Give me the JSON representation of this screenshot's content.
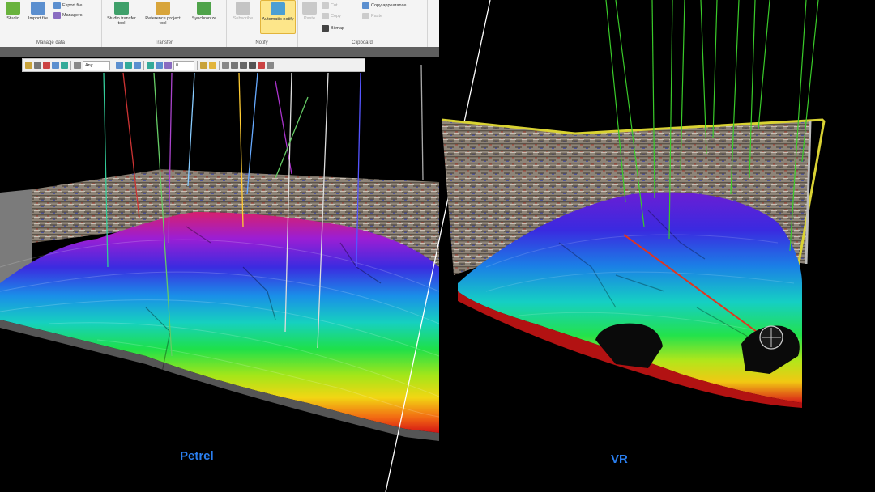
{
  "ribbon": {
    "groups": [
      {
        "title": "Manage data",
        "buttons": [
          {
            "label": "Studio"
          },
          {
            "label": "Import file"
          }
        ],
        "small": [
          {
            "label": "Export file"
          },
          {
            "label": "Managers"
          }
        ]
      },
      {
        "title": "Transfer",
        "buttons": [
          {
            "label": "Studio transfer tool"
          },
          {
            "label": "Reference project tool"
          },
          {
            "label": "Synchronize"
          }
        ]
      },
      {
        "title": "Notify",
        "buttons": [
          {
            "label": "Subscribe"
          },
          {
            "label": "Automatic notify"
          }
        ]
      },
      {
        "title": "Clipboard",
        "buttons": [
          {
            "label": "Paste"
          }
        ],
        "small": [
          {
            "label": "Cut"
          },
          {
            "label": "Copy"
          },
          {
            "label": "Bitmap"
          },
          {
            "label": "Copy appearance"
          },
          {
            "label": "Paste"
          }
        ]
      }
    ]
  },
  "toolbar": {
    "dropdown1": "Any",
    "dropdown2": "0"
  },
  "captions": {
    "left": "Petrel",
    "right": "VR"
  },
  "colors": {
    "accent": "#2a7ff0",
    "ribbon_bg": "#f4f4f4",
    "frame_yellow": "#d9d233"
  }
}
